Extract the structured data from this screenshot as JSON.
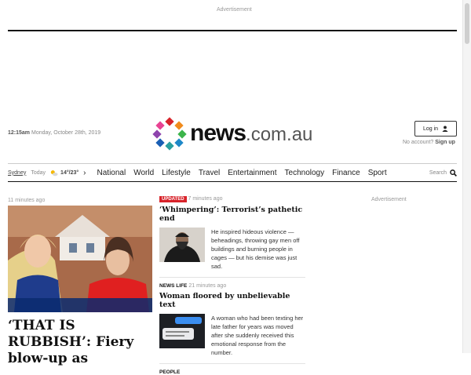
{
  "ads": {
    "top_label": "Advertisement",
    "right_label": "Advertisement"
  },
  "header": {
    "time": "12:15am",
    "date": "Monday, October 28th, 2019",
    "logo_main": "news",
    "logo_suffix": ".com.au",
    "login_label": "Log in",
    "no_account_text": "No account?",
    "signup_label": "Sign up"
  },
  "nav": {
    "location": "Sydney",
    "today_label": "Today",
    "weather": "14°/23°",
    "items": [
      "National",
      "World",
      "Lifestyle",
      "Travel",
      "Entertainment",
      "Technology",
      "Finance",
      "Sport"
    ],
    "search_label": "Search"
  },
  "lead": {
    "time": "11 minutes ago",
    "title": "‘THAT IS RUBBISH’: Fiery blow-up as"
  },
  "stories": [
    {
      "badge": "UPDATED",
      "time": "7 minutes ago",
      "title": "‘Whimpering’: Terrorist’s pathetic end",
      "summary": "He inspired hideous violence — beheadings, throwing gay men off buildings and burning people in cages — but his demise was just sad."
    },
    {
      "section": "NEWS LIFE",
      "time": "21 minutes ago",
      "title": "Woman floored by unbelievable text",
      "summary": "A woman who had been texting her late father for years was moved after she suddenly received this emotional response from the number."
    },
    {
      "section": "PEOPLE"
    }
  ],
  "colors": {
    "brand_red": "#d8232a",
    "text": "#222222",
    "muted": "#999999"
  },
  "icons": {
    "login": "user-icon",
    "weather": "sun-cloud-icon",
    "search": "magnifier-icon",
    "nav_more": "chevron-right-icon"
  }
}
